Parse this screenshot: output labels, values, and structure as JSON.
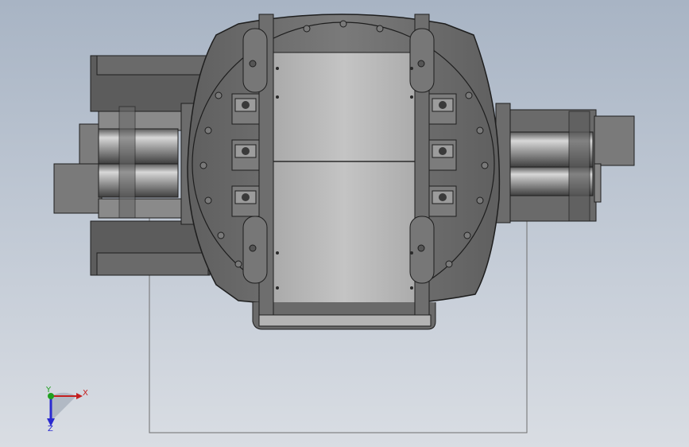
{
  "viewport": {
    "background_top": "#a8b4c4",
    "background_bottom": "#d9dde3"
  },
  "model": {
    "body_color": "#6f6f6f",
    "body_edge": "#1e1e1e",
    "plate_color": "#bdbdbd",
    "roller_light": "#d4d4d4",
    "roller_dark": "#4a4a4a"
  },
  "triad": {
    "x_label": "X",
    "y_label": "Y",
    "z_label": "Z",
    "x_color": "#c42020",
    "y_color": "#1fa01f",
    "z_color": "#2a2ad0"
  }
}
